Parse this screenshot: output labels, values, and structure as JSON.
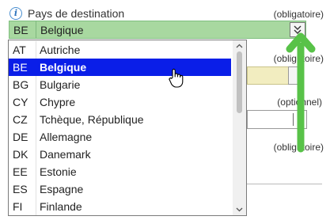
{
  "field": {
    "label": "Pays de destination",
    "required_label": "(obligatoire)",
    "selected_code": "BE",
    "selected_name": "Belgique",
    "dropdown_glyph": "«"
  },
  "background_fields": {
    "label2": "(obligatoire)",
    "label3": "(optionnel)",
    "label4": "(obligatoire)"
  },
  "dropdown": {
    "items": [
      {
        "code": "AT",
        "name": "Autriche"
      },
      {
        "code": "BE",
        "name": "Belgique"
      },
      {
        "code": "BG",
        "name": "Bulgarie"
      },
      {
        "code": "CY",
        "name": "Chypre"
      },
      {
        "code": "CZ",
        "name": "Tchèque, République"
      },
      {
        "code": "DE",
        "name": "Allemagne"
      },
      {
        "code": "DK",
        "name": "Danemark"
      },
      {
        "code": "EE",
        "name": "Estonie"
      },
      {
        "code": "ES",
        "name": "Espagne"
      },
      {
        "code": "FI",
        "name": "Finlande"
      }
    ],
    "selected_index": 1,
    "scroll_up_glyph": "▲",
    "scroll_down_glyph": "▼"
  },
  "colors": {
    "selected_bg": "#0a1ee8",
    "field_green": "#a8d8a0",
    "arrow_green": "#58c248",
    "info_blue": "#4a8fd0"
  },
  "icons": {
    "info": "info-icon",
    "cursor": "hand-cursor-icon",
    "annotation": "arrow-up-icon"
  }
}
